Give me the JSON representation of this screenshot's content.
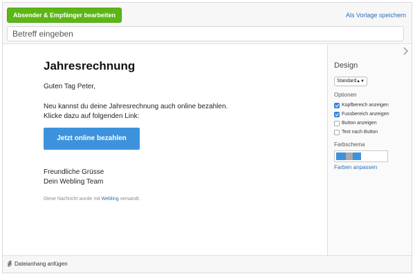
{
  "toolbar": {
    "edit_recipients_label": "Absender & Empfänger bearbeiten",
    "save_template_label": "Als Vorlage speichern"
  },
  "subject": {
    "placeholder": "Betreff eingeben"
  },
  "email": {
    "title": "Jahresrechnung",
    "greeting": "Guten Tag Peter,",
    "body_line1": "Neu kannst du deine Jahresrechnung auch online bezahlen.",
    "body_line2": "Klicke dazu auf folgenden Link:",
    "pay_button": "Jetzt online bezahlen",
    "closing_line1": "Freundliche Grüsse",
    "closing_line2": "Dein Webling Team",
    "footer_prefix": "Diese Nachricht wurde mit",
    "footer_link": "Webling",
    "footer_suffix": "versandt."
  },
  "sidebar": {
    "collapse_icon": "chevron-right-icon",
    "title": "Design",
    "design_select_value": "Standard",
    "options_title": "Optionen",
    "options": [
      {
        "label": "Kopfbereich anzeigen",
        "checked": true
      },
      {
        "label": "Fussbereich anzeigen",
        "checked": true
      },
      {
        "label": "Button anzeigen",
        "checked": false
      },
      {
        "label": "Text nach Button",
        "checked": false
      }
    ],
    "color_scheme_title": "Farbschema",
    "color_scheme_colors": [
      "#3d93db",
      "#a9a9a9",
      "#3d93db"
    ],
    "adjust_colors_label": "Farben anpassen"
  },
  "footer": {
    "attach_icon": "paperclip-icon",
    "attach_label": "Dateianhang anfügen"
  },
  "colors": {
    "primary_green": "#5cb615",
    "accent_blue": "#3d93db",
    "link_blue": "#2f6fb5"
  }
}
